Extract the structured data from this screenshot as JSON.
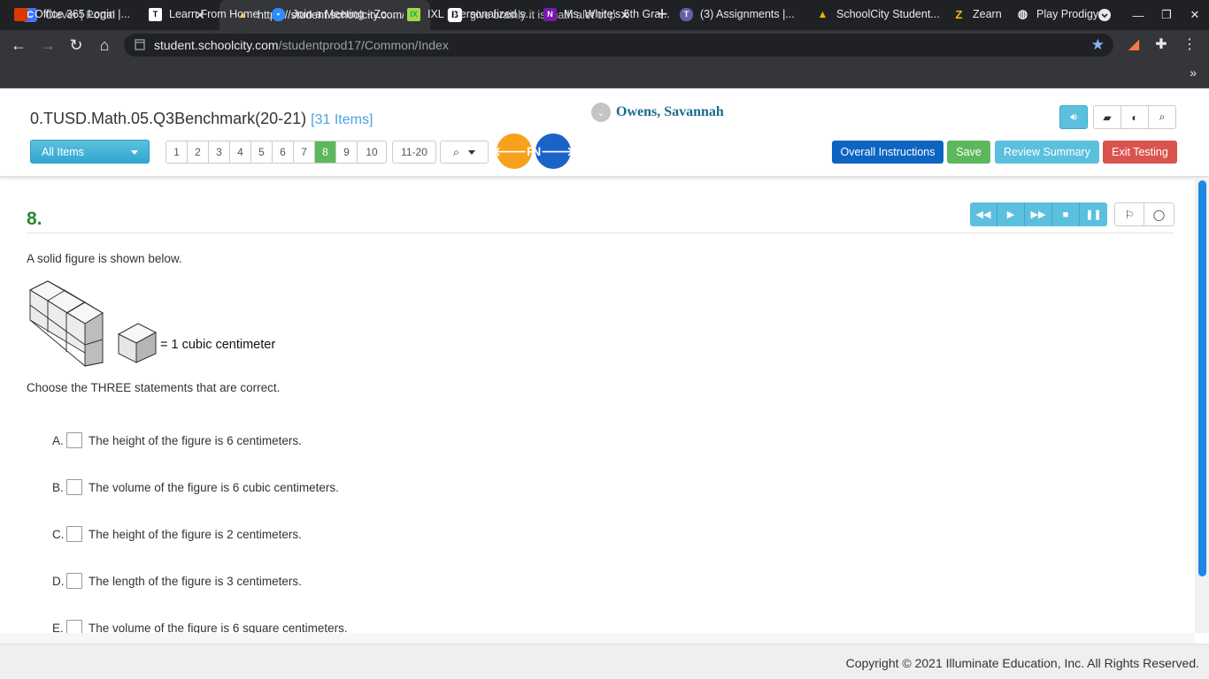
{
  "browser": {
    "tabs": [
      {
        "title": "Clever | Portal",
        "icon": "clever-icon"
      },
      {
        "title": "https://student.schoolcity.com/s",
        "icon": "schoolcity-icon"
      },
      {
        "title": "give brainly it is math alot of poi",
        "icon": "brainly-icon"
      }
    ],
    "url_host": "student.schoolcity.com",
    "url_path": "/studentprod17/Common/Index",
    "bookmarks": [
      {
        "label": "Office 365 Login |...",
        "icon": "office-icon",
        "color": "#d83b01"
      },
      {
        "label": "Learn From Home",
        "icon": "t-icon",
        "color": "#ffffff"
      },
      {
        "label": "Join a Meeting - Zo...",
        "icon": "zoom-icon",
        "color": "#2d8cff"
      },
      {
        "label": "IXL | Personalized s...",
        "icon": "ixl-icon",
        "color": "#a6d74a"
      },
      {
        "label": "Ms. White's 5th Gra...",
        "icon": "onenote-icon",
        "color": "#7719aa"
      },
      {
        "label": "(3) Assignments |...",
        "icon": "teams-icon",
        "color": "#6264a7"
      },
      {
        "label": "SchoolCity Student...",
        "icon": "schoolcity-icon",
        "color": "#f4b400"
      },
      {
        "label": "Zearn",
        "icon": "zearn-icon",
        "color": "#fbbc04"
      },
      {
        "label": "Play Prodigy",
        "icon": "globe-icon",
        "color": "#e8eaed"
      }
    ]
  },
  "test": {
    "name": "0.TUSD.Math.05.Q3Benchmark(20-21)",
    "item_count": "[31 Items]",
    "student": "Owens, Savannah",
    "filter_label": "All Items",
    "pages": [
      "1",
      "2",
      "3",
      "4",
      "5",
      "6",
      "7",
      "8",
      "9",
      "10"
    ],
    "current_page": "8",
    "range_label": "11-20",
    "prev_label": "P",
    "next_label": "N",
    "buttons": {
      "instructions": "Overall Instructions",
      "save": "Save",
      "review": "Review Summary",
      "exit": "Exit Testing"
    }
  },
  "question": {
    "number": "8.",
    "stem": "A solid figure is shown below.",
    "unit_label": "= 1 cubic centimeter",
    "prompt": "Choose the THREE statements that are correct.",
    "choices": [
      {
        "letter": "A.",
        "text": "The height of the figure is 6 centimeters."
      },
      {
        "letter": "B.",
        "text": "The volume of the figure is 6 cubic centimeters."
      },
      {
        "letter": "C.",
        "text": "The height of the figure is 2 centimeters."
      },
      {
        "letter": "D.",
        "text": "The length of the figure is 3 centimeters."
      },
      {
        "letter": "E.",
        "text": "The volume of the figure is 6 square centimeters."
      }
    ]
  },
  "footer": {
    "copyright": "Copyright © 2021 Illuminate Education, Inc. All Rights Reserved."
  }
}
